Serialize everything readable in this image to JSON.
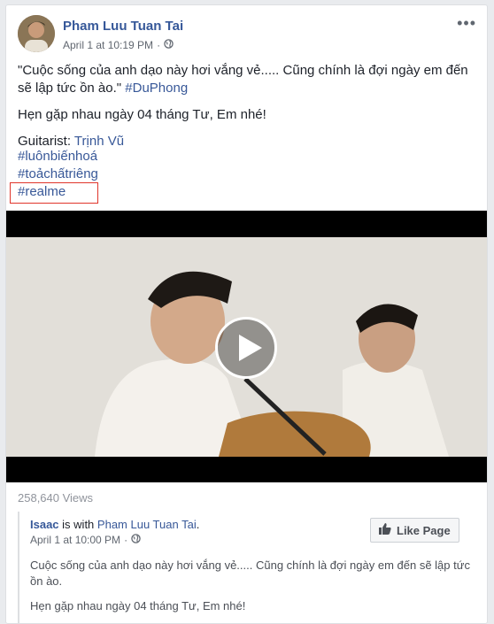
{
  "post": {
    "author": "Pham Luu Tuan Tai",
    "timestamp": "April 1 at 10:19 PM",
    "separator": "·",
    "more_label": "•••",
    "quote": "\"Cuộc sống của anh dạo này hơi vắng vẻ..... Cũng chính là đợi ngày em đến sẽ lập tức ồn ào.\"",
    "quote_tag": "#DuPhong",
    "line2": "Hẹn gặp nhau ngày 04 tháng Tư, Em nhé!",
    "guitarist_label": "Guitarist:",
    "guitarist_name": "Trịnh Vũ",
    "hashtags": [
      "#luônbiếnhoá",
      "#toảchấtriêng",
      "#realme"
    ],
    "views": "258,640 Views"
  },
  "shared": {
    "user": "Isaac",
    "with_text": "is with",
    "with_user": "Pham Luu Tuan Tai",
    "timestamp": "April 1 at 10:00 PM",
    "separator": "·",
    "like_page": "Like Page",
    "text1": "Cuộc sống của anh dạo này hơi vắng vẻ..... Cũng chính là đợi ngày em đến sẽ lập tức ồn ào.",
    "text2": "Hẹn gặp nhau ngày 04 tháng Tư, Em nhé!"
  },
  "colors": {
    "link": "#385898",
    "highlight_box": "#e0352b"
  },
  "icons": {
    "privacy": "globe-icon",
    "like": "thumbs-up-icon",
    "play": "play-icon",
    "more": "more-options-icon"
  }
}
